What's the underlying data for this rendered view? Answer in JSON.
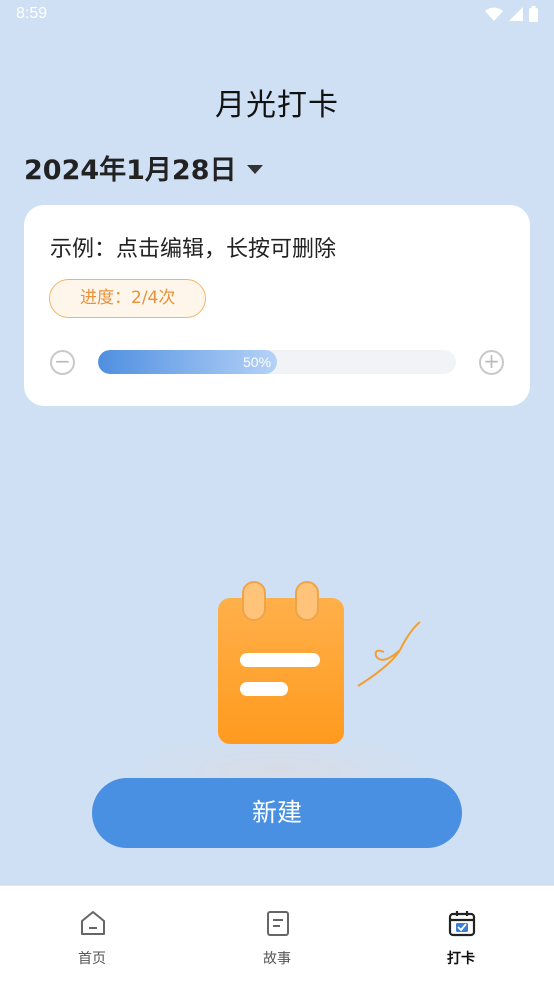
{
  "status_bar": {
    "time": "8:59"
  },
  "header": {
    "title": "月光打卡"
  },
  "date_selector": {
    "date": "2024年1月28日"
  },
  "task_card": {
    "title": "示例：点击编辑，长按可删除",
    "progress_label": "进度：2/4次",
    "progress_percent_text": "50%",
    "progress_fraction": 0.5
  },
  "actions": {
    "new_label": "新建"
  },
  "tabbar": {
    "items": [
      {
        "label": "首页",
        "icon": "home-icon"
      },
      {
        "label": "故事",
        "icon": "story-icon"
      },
      {
        "label": "打卡",
        "icon": "checkin-calendar-icon",
        "active": true
      }
    ]
  },
  "colors": {
    "accent": "#4a90e2",
    "background": "#cfe0f5",
    "badge_text": "#e8913a",
    "notepad": "#ffa633"
  }
}
